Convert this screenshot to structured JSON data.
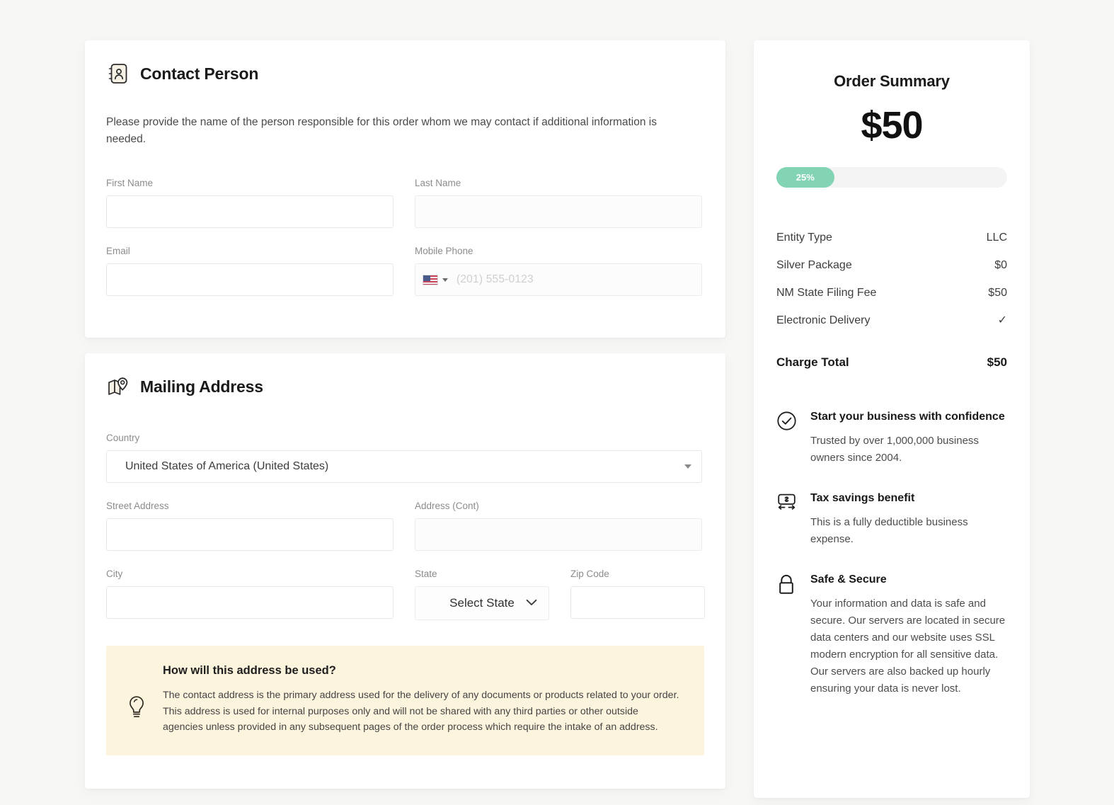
{
  "contact": {
    "section_title": "Contact Person",
    "icon": "contact-card-icon",
    "description": "Please provide the name of the person responsible for this order whom we may contact if additional information is needed.",
    "fields": {
      "first_name": {
        "label": "First Name",
        "value": "",
        "placeholder": ""
      },
      "last_name": {
        "label": "Last Name",
        "value": "",
        "placeholder": ""
      },
      "email": {
        "label": "Email",
        "value": "",
        "placeholder": ""
      },
      "mobile_phone": {
        "label": "Mobile Phone",
        "value": "",
        "placeholder": "(201) 555-0123",
        "country_flag": "us-flag-icon"
      }
    }
  },
  "mailing": {
    "section_title": "Mailing Address",
    "icon": "map-pin-icon",
    "fields": {
      "country": {
        "label": "Country",
        "value": "United States of America (United States)"
      },
      "street_address": {
        "label": "Street Address",
        "value": "",
        "placeholder": ""
      },
      "address_cont": {
        "label": "Address (Cont)",
        "value": "",
        "placeholder": ""
      },
      "city": {
        "label": "City",
        "value": "",
        "placeholder": ""
      },
      "state": {
        "label": "State",
        "value": "Select State"
      },
      "zip_code": {
        "label": "Zip Code",
        "value": "",
        "placeholder": ""
      }
    },
    "banner": {
      "icon": "lightbulb-icon",
      "title": "How will this address be used?",
      "text": "The contact address is the primary address used for the delivery of any documents or products related to your order. This address is used for internal purposes only and will not be shared with any third parties or other outside agencies unless provided in any subsequent pages of the order process which require the intake of an address.",
      "background_color": "#fdf4dd"
    }
  },
  "order_summary": {
    "title": "Order Summary",
    "amount": "$50",
    "progress": {
      "label": "25%",
      "percent": 25,
      "fill_color": "#83d4b5",
      "track_color": "#f4f4f4"
    },
    "line_items": [
      {
        "label": "Entity Type",
        "value": "LLC"
      },
      {
        "label": "Silver Package",
        "value": "$0"
      },
      {
        "label": "NM State Filing Fee",
        "value": "$50"
      },
      {
        "label": "Electronic Delivery",
        "value": "✓",
        "is_check": true
      }
    ],
    "total": {
      "label": "Charge Total",
      "value": "$50"
    },
    "benefits": [
      {
        "icon": "check-circle-icon",
        "title": "Start your business with confidence",
        "text": "Trusted by over 1,000,000 business owners since 2004."
      },
      {
        "icon": "money-exchange-icon",
        "title": "Tax savings benefit",
        "text": "This is a fully deductible business expense."
      },
      {
        "icon": "lock-icon",
        "title": "Safe & Secure",
        "text": "Your information and data is safe and secure. Our servers are located in secure data centers and our website uses SSL modern encryption for all sensitive data. Our servers are also backed up hourly ensuring your data is never lost."
      }
    ]
  }
}
